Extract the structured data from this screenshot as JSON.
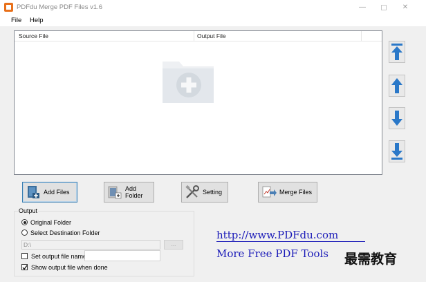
{
  "window": {
    "title": "PDFdu Merge PDF Files v1.6",
    "controls": {
      "minimize": "—",
      "maximize": "",
      "close": "✕"
    }
  },
  "menu": {
    "items": [
      "File",
      "Help"
    ]
  },
  "file_list": {
    "columns": [
      "Source File",
      "Output File"
    ],
    "rows": [],
    "empty_icon": "add-folder-icon"
  },
  "side_buttons": [
    {
      "name": "move-top",
      "icon": "arrow-to-top-icon"
    },
    {
      "name": "move-up",
      "icon": "arrow-up-icon"
    },
    {
      "name": "move-down",
      "icon": "arrow-down-icon"
    },
    {
      "name": "move-bottom",
      "icon": "arrow-to-bottom-icon"
    }
  ],
  "actions": {
    "add_files": "Add Files",
    "add_folder": "Add Folder",
    "setting": "Setting",
    "merge_files": "Merge Files"
  },
  "output": {
    "title": "Output",
    "original_folder": "Original Folder",
    "select_destination": "Select Destination Folder",
    "selected": "original_folder",
    "destination_value": "D:\\",
    "browse_label": "...",
    "set_output_name_label": "Set output file name",
    "set_output_name_checked": false,
    "output_name_value": "",
    "show_output_label": "Show output file when done",
    "show_output_checked": true
  },
  "promo": {
    "url": "http://www.PDFdu.com",
    "more": "More Free PDF Tools",
    "corner_mark": "最需教育"
  },
  "colors": {
    "accent": "#3c7fb1",
    "link": "#1a1ab8",
    "arrow": "#2a78c8",
    "panel": "#f0f0f0"
  }
}
